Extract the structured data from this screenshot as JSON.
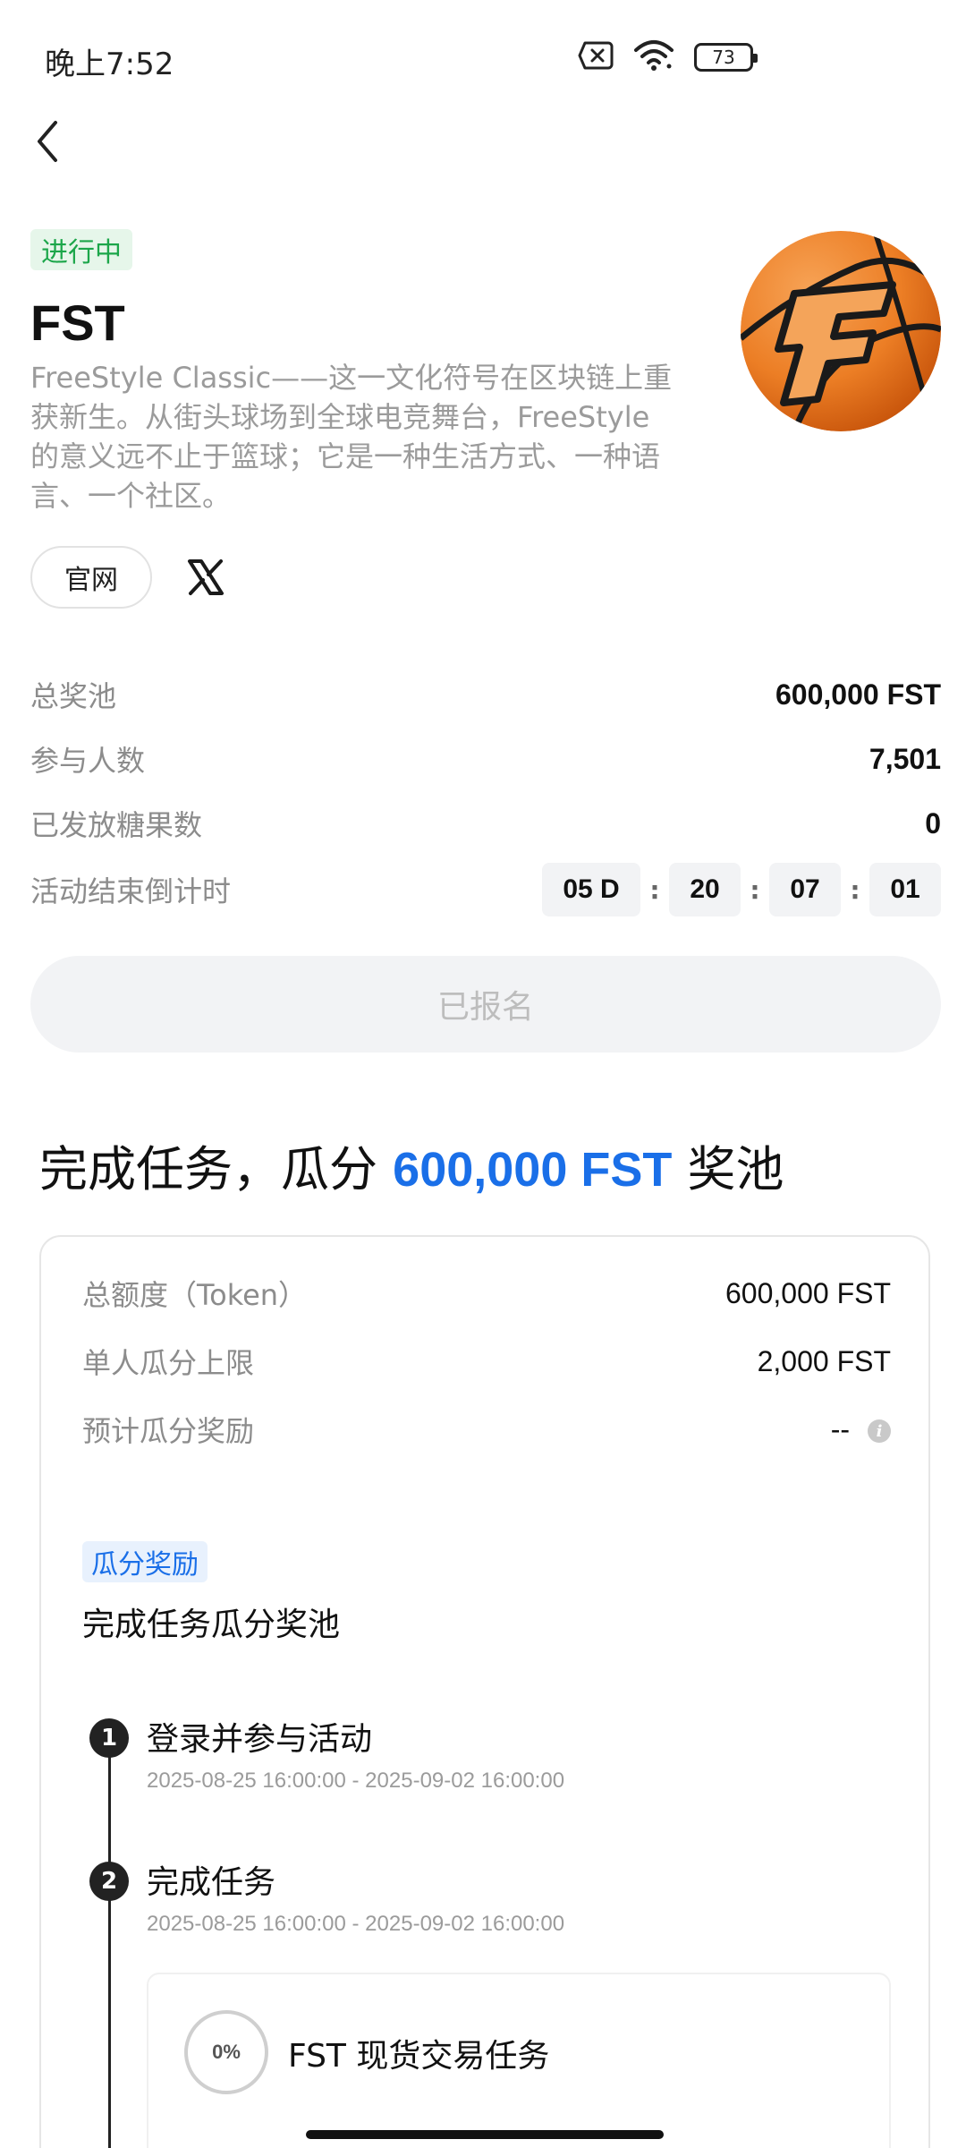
{
  "status_bar": {
    "time": "晚上7:52",
    "battery": "73",
    "icons": [
      "sim-off-icon",
      "wifi-icon",
      "battery-icon"
    ]
  },
  "header": {
    "status_tag": "进行中",
    "title": "FST",
    "description": "FreeStyle Classic——这一文化符号在区块链上重获新生。从街头球场到全球电竞舞台，FreeStyle 的意义远不止于篮球；它是一种生活方式、一种语言、一个社区。",
    "website_label": "官网",
    "logo": "freestyle-basketball-logo"
  },
  "stats": {
    "total_pool_label": "总奖池",
    "total_pool_value": "600,000 FST",
    "participants_label": "参与人数",
    "participants_value": "7,501",
    "candies_label": "已发放糖果数",
    "candies_value": "0",
    "countdown_label": "活动结束倒计时",
    "countdown_days": "05 D",
    "countdown_hours": "20",
    "countdown_minutes": "07",
    "countdown_seconds": "01",
    "countdown_sep": ":"
  },
  "register_button": "已报名",
  "section": {
    "title_prefix": "完成任务，瓜分 ",
    "title_amount": "600,000 FST",
    "title_suffix": " 奖池"
  },
  "card": {
    "total_label": "总额度（Token）",
    "total_value": "600,000 FST",
    "cap_label": "单人瓜分上限",
    "cap_value": "2,000 FST",
    "estimate_label": "预计瓜分奖励",
    "estimate_value": "--",
    "reward_tag": "瓜分奖励",
    "reward_desc": "完成任务瓜分奖池",
    "steps": [
      {
        "num": "1",
        "title": "登录并参与活动",
        "time": "2025-08-25 16:00:00 - 2025-09-02 16:00:00"
      },
      {
        "num": "2",
        "title": "完成任务",
        "time": "2025-08-25 16:00:00 - 2025-09-02 16:00:00"
      }
    ],
    "subtask": {
      "progress": "0%",
      "title": "FST 现货交易任务"
    }
  },
  "colors": {
    "accent_blue": "#1a6fe8",
    "status_green": "#1ca64a",
    "muted_text": "#8c8c8c"
  }
}
